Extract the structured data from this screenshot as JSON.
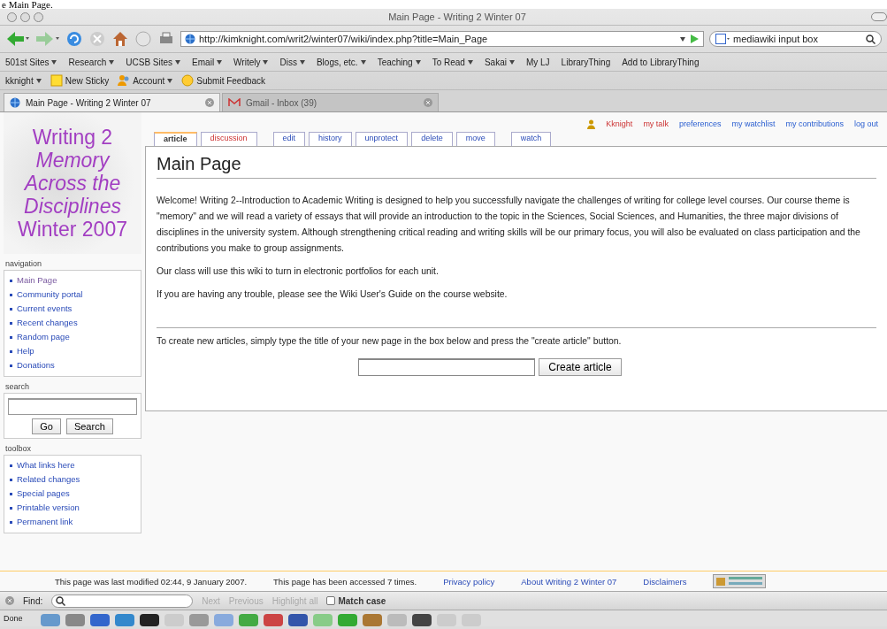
{
  "doc_fragment": "e Main Page.",
  "window": {
    "title": "Main Page - Writing 2 Winter 07"
  },
  "toolbar": {
    "url": "http://kimknight.com/writ2/winter07/wiki/index.php?title=Main_Page",
    "search": "mediawiki input box"
  },
  "bookmarks": [
    {
      "label": "501st Sites",
      "menu": true
    },
    {
      "label": "Research",
      "menu": true
    },
    {
      "label": "UCSB Sites",
      "menu": true
    },
    {
      "label": "Email",
      "menu": true
    },
    {
      "label": "Writely",
      "menu": true
    },
    {
      "label": "Diss",
      "menu": true
    },
    {
      "label": "Blogs, etc.",
      "menu": true
    },
    {
      "label": "Teaching",
      "menu": true
    },
    {
      "label": "To Read",
      "menu": true
    },
    {
      "label": "Sakai",
      "menu": true
    },
    {
      "label": "My LJ",
      "menu": false
    },
    {
      "label": "LibraryThing",
      "menu": false
    },
    {
      "label": "Add to LibraryThing",
      "menu": false
    }
  ],
  "personal_toolbar": [
    {
      "label": "kknight",
      "kind": "plain",
      "menu": true
    },
    {
      "label": "New Sticky",
      "kind": "sticky",
      "menu": false
    },
    {
      "label": "Account",
      "kind": "account",
      "menu": true
    },
    {
      "label": "Submit Feedback",
      "kind": "feedback",
      "menu": false
    }
  ],
  "tabs": [
    {
      "label": "Main Page - Writing 2 Winter 07",
      "selected": true
    },
    {
      "label": "Gmail - Inbox (39)",
      "selected": false
    }
  ],
  "logo": [
    {
      "text": "Writing 2",
      "italic": false
    },
    {
      "text": "Memory",
      "italic": true
    },
    {
      "text": "Across the",
      "italic": true
    },
    {
      "text": "Disciplines",
      "italic": true
    },
    {
      "text": "Winter 2007",
      "italic": false
    }
  ],
  "user_links": [
    {
      "label": "Kknight",
      "missing": true
    },
    {
      "label": "my talk",
      "missing": true
    },
    {
      "label": "preferences",
      "missing": false
    },
    {
      "label": "my watchlist",
      "missing": false
    },
    {
      "label": "my contributions",
      "missing": false
    },
    {
      "label": "log out",
      "missing": false
    }
  ],
  "page_tabs": [
    {
      "label": "article",
      "selected": true,
      "missing": false
    },
    {
      "label": "discussion",
      "selected": false,
      "missing": true
    },
    {
      "label": "edit",
      "selected": false,
      "missing": false
    },
    {
      "label": "history",
      "selected": false,
      "missing": false
    },
    {
      "label": "unprotect",
      "selected": false,
      "missing": false
    },
    {
      "label": "delete",
      "selected": false,
      "missing": false
    },
    {
      "label": "move",
      "selected": false,
      "missing": false
    },
    {
      "label": "watch",
      "selected": false,
      "missing": false
    }
  ],
  "heading": "Main Page",
  "paragraphs": [
    "Welcome! Writing 2--Introduction to Academic Writing is designed to help you successfully navigate the challenges of writing for college level courses. Our course theme is \"memory\" and we will read a variety of essays that will provide an introduction to the topic in the Sciences, Social Sciences, and Humanities, the three major divisions of disciplines in the university system. Although strengthening critical reading and writing skills will be our primary focus, you will also be evaluated on class participation and the contributions you make to group assignments.",
    "Our class will use this wiki to turn in electronic portfolios for each unit.",
    "If you are having any trouble, please see the Wiki User's Guide on the course website."
  ],
  "create_text": "To create new articles, simply type the title of your new page in the box below and press the \"create article\" button.",
  "create_button": "Create article",
  "navigation": {
    "label": "navigation",
    "items": [
      {
        "label": "Main Page",
        "visited": true
      },
      {
        "label": "Community portal",
        "visited": false
      },
      {
        "label": "Current events",
        "visited": false
      },
      {
        "label": "Recent changes",
        "visited": false
      },
      {
        "label": "Random page",
        "visited": false
      },
      {
        "label": "Help",
        "visited": false
      },
      {
        "label": "Donations",
        "visited": false
      }
    ]
  },
  "search": {
    "label": "search",
    "buttons": [
      "Go",
      "Search"
    ]
  },
  "toolbox": {
    "label": "toolbox",
    "items": [
      {
        "label": "What links here",
        "visited": false
      },
      {
        "label": "Related changes",
        "visited": false
      },
      {
        "label": "Special pages",
        "visited": false
      },
      {
        "label": "Printable version",
        "visited": false
      },
      {
        "label": "Permanent link",
        "visited": false
      }
    ]
  },
  "footer": [
    {
      "text": "This page was last modified 02:44, 9 January 2007.",
      "link": false
    },
    {
      "text": "This page has been accessed 7 times.",
      "link": false
    },
    {
      "text": "Privacy policy",
      "link": true
    },
    {
      "text": "About Writing 2 Winter 07",
      "link": true
    },
    {
      "text": "Disclaimers",
      "link": true
    }
  ],
  "find_bar": {
    "label": "Find:",
    "next": "Next",
    "previous": "Previous",
    "highlight": "Highlight all",
    "match_case": {
      "label": "Match case",
      "checked": false
    }
  },
  "status": "Done"
}
